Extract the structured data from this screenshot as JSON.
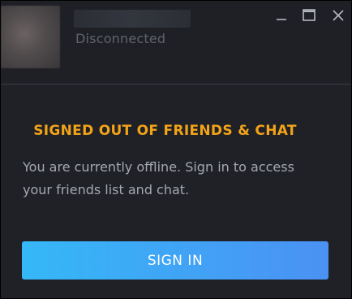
{
  "header": {
    "status_text": "Disconnected",
    "window_controls": {
      "minimize_icon": "minimize-icon",
      "maximize_icon": "maximize-icon",
      "close_icon": "close-icon"
    }
  },
  "main": {
    "title": "SIGNED OUT OF FRIENDS & CHAT",
    "message": "You are currently offline. Sign in to access your friends list and chat.",
    "sign_in_label": "SIGN IN"
  },
  "colors": {
    "background": "#1e2026",
    "title_accent": "#f2a318",
    "message_text": "#a4a8b0",
    "status_text": "#5f636b",
    "button_gradient_start": "#35b8f7",
    "button_gradient_end": "#4b91f4"
  }
}
